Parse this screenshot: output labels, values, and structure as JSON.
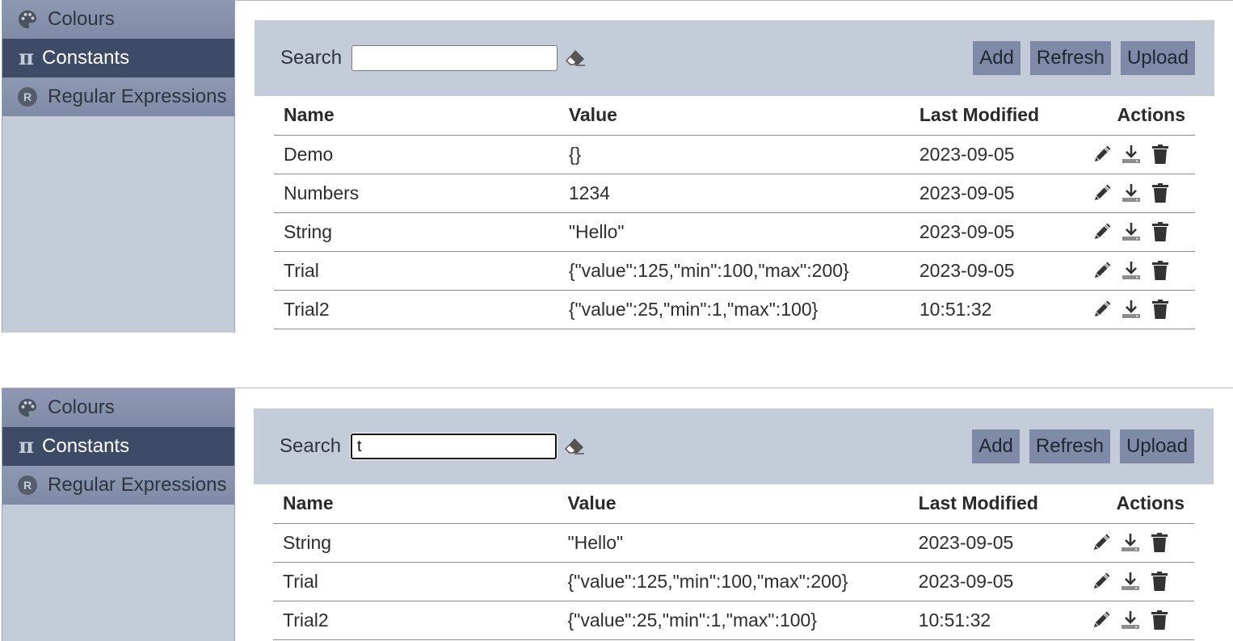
{
  "sidebar": {
    "items": [
      {
        "label": "Colours",
        "icon": "palette-icon"
      },
      {
        "label": "Constants",
        "icon": "pi-icon"
      },
      {
        "label": "Regular Expressions",
        "icon": "r-icon"
      }
    ],
    "pi_glyph": "π",
    "r_glyph": "R"
  },
  "toolbar": {
    "search_label": "Search",
    "add_label": "Add",
    "refresh_label": "Refresh",
    "upload_label": "Upload"
  },
  "table": {
    "headers": {
      "name": "Name",
      "value": "Value",
      "modified": "Last Modified",
      "actions": "Actions"
    }
  },
  "panel1": {
    "search_value": "",
    "rows": [
      {
        "name": "Demo",
        "value": "{}",
        "modified": "2023-09-05"
      },
      {
        "name": "Numbers",
        "value": "1234",
        "modified": "2023-09-05"
      },
      {
        "name": "String",
        "value": "\"Hello\"",
        "modified": "2023-09-05"
      },
      {
        "name": "Trial",
        "value": "{\"value\":125,\"min\":100,\"max\":200}",
        "modified": "2023-09-05"
      },
      {
        "name": "Trial2",
        "value": "{\"value\":25,\"min\":1,\"max\":100}",
        "modified": "10:51:32"
      }
    ]
  },
  "panel2": {
    "search_value": "t",
    "rows": [
      {
        "name": "String",
        "value": "\"Hello\"",
        "modified": "2023-09-05"
      },
      {
        "name": "Trial",
        "value": "{\"value\":125,\"min\":100,\"max\":200}",
        "modified": "2023-09-05"
      },
      {
        "name": "Trial2",
        "value": "{\"value\":25,\"min\":1,\"max\":100}",
        "modified": "10:51:32"
      }
    ]
  },
  "colors": {
    "sidebar_bg": "#c5ccd9",
    "nav_active": "#3d4b67",
    "button_bg": "#7f8ba6"
  }
}
